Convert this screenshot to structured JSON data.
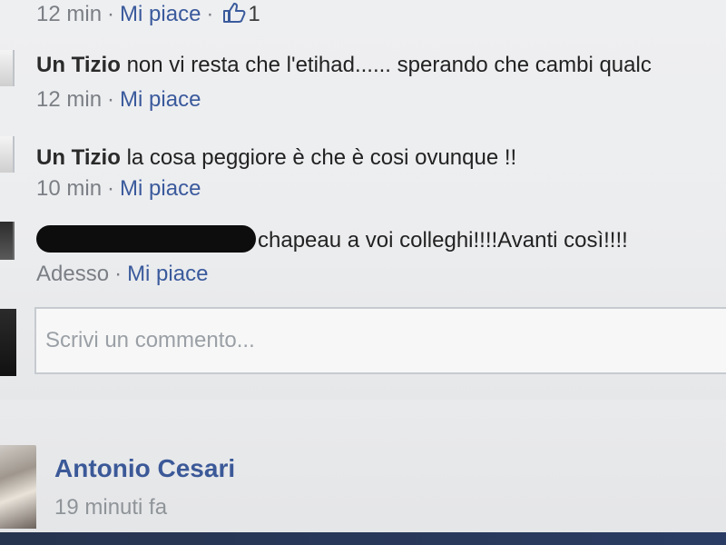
{
  "thread": {
    "top_meta": {
      "time": "12 min",
      "sep": "·",
      "like": "Mi piace",
      "sep2": "·",
      "like_count": "1"
    },
    "comments": [
      {
        "author": "Un Tizio",
        "text": "non vi resta che l'etihad...... sperando che cambi qualc",
        "time": "12 min",
        "sep": "·",
        "like": "Mi piace"
      },
      {
        "author": "Un Tizio",
        "text": "la cosa peggiore è che è cosi ovunque !!",
        "time": "10 min",
        "sep": "·",
        "like": "Mi piace"
      },
      {
        "author": "",
        "text": "chapeau a voi colleghi!!!!Avanti così!!!!",
        "time": "Adesso",
        "sep": "·",
        "like": "Mi piace"
      }
    ],
    "composer": {
      "placeholder": "Scrivi un commento..."
    }
  },
  "post": {
    "author": "Antonio Cesari",
    "time": "19 minuti fa"
  },
  "icons": {
    "thumb": "thumbs-up-icon"
  }
}
